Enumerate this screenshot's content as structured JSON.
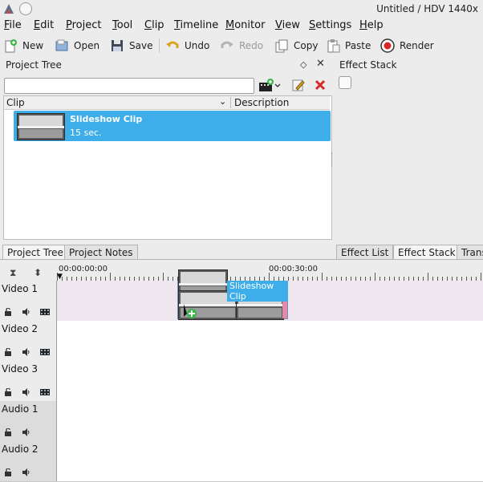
{
  "window": {
    "title": "Untitled / HDV 1440x"
  },
  "menu": [
    {
      "label": "File",
      "u": "F",
      "rest": "ile"
    },
    {
      "label": "Edit",
      "u": "E",
      "rest": "dit"
    },
    {
      "label": "Project",
      "u": "P",
      "rest": "roject"
    },
    {
      "label": "Tool",
      "u": "T",
      "rest": "ool"
    },
    {
      "label": "Clip",
      "u": "C",
      "rest": "lip"
    },
    {
      "label": "Timeline",
      "u": "T",
      "rest": "imeline"
    },
    {
      "label": "Monitor",
      "u": "M",
      "rest": "onitor"
    },
    {
      "label": "View",
      "u": "V",
      "rest": "iew"
    },
    {
      "label": "Settings",
      "u": "S",
      "rest": "ettings"
    },
    {
      "label": "Help",
      "u": "H",
      "rest": "elp"
    }
  ],
  "toolbar": {
    "new": "New",
    "open": "Open",
    "save": "Save",
    "undo": "Undo",
    "redo": "Redo",
    "copy": "Copy",
    "paste": "Paste",
    "render": "Render"
  },
  "project_tree": {
    "title": "Project Tree",
    "search_value": "",
    "columns": {
      "clip": "Clip",
      "description": "Description"
    },
    "clips": [
      {
        "name": "Slideshow Clip",
        "duration": "15 sec."
      }
    ]
  },
  "effect_stack": {
    "title": "Effect Stack"
  },
  "tabs_left": [
    "Project Tree",
    "Project Notes"
  ],
  "tabs_right": [
    "Effect List",
    "Effect Stack",
    "Trans"
  ],
  "timeline": {
    "ruler_labels": [
      "00:00:00:00",
      "00:00:30:00"
    ],
    "clip_label": "Slideshow Clip",
    "tracks": [
      {
        "name": "Video 1",
        "kind": "video"
      },
      {
        "name": "Video 2",
        "kind": "video"
      },
      {
        "name": "Video 3",
        "kind": "video"
      },
      {
        "name": "Audio 1",
        "kind": "audio"
      },
      {
        "name": "Audio 2",
        "kind": "audio"
      }
    ]
  },
  "colors": {
    "selection": "#3daee9",
    "accent_red": "#d62828",
    "video1_lane": "#f0e6f0"
  }
}
